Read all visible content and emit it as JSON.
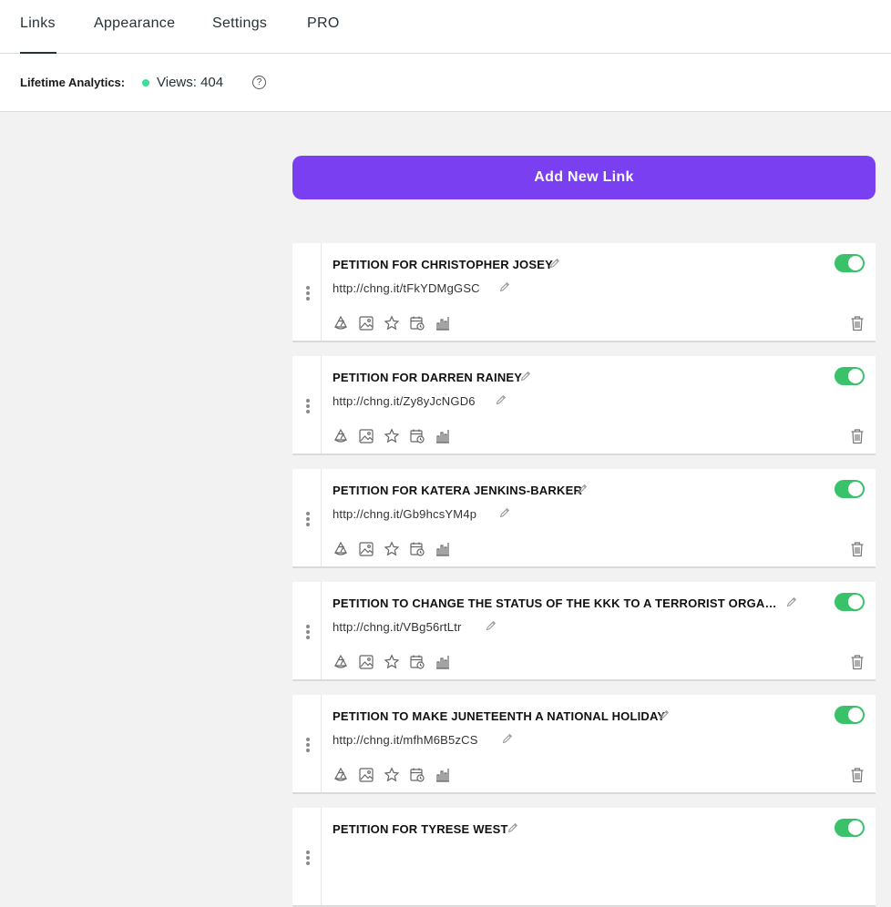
{
  "tabs": [
    {
      "label": "Links",
      "active": true
    },
    {
      "label": "Appearance",
      "active": false
    },
    {
      "label": "Settings",
      "active": false
    },
    {
      "label": "PRO",
      "active": false
    }
  ],
  "analytics": {
    "label": "Lifetime Analytics:",
    "views": "Views: 404",
    "help": "?"
  },
  "add_button": "Add New Link",
  "links": [
    {
      "title": "PETITION FOR CHRISTOPHER JOSEY",
      "url": "http://chng.it/tFkYDMgGSC",
      "enabled": true
    },
    {
      "title": "PETITION FOR DARREN RAINEY",
      "url": "http://chng.it/Zy8yJcNGD6",
      "enabled": true
    },
    {
      "title": "PETITION FOR KATERA JENKINS-BARKER",
      "url": "http://chng.it/Gb9hcsYM4p",
      "enabled": true
    },
    {
      "title": "PETITION TO CHANGE THE STATUS OF THE KKK TO A TERRORIST ORGANIZ...",
      "url": "http://chng.it/VBg56rtLtr",
      "enabled": true
    },
    {
      "title": "PETITION TO MAKE JUNETEENTH A NATIONAL HOLIDAY",
      "url": "http://chng.it/mfhM6B5zCS",
      "enabled": true
    },
    {
      "title": "PETITION FOR TYRESE WEST",
      "url": "",
      "enabled": true
    }
  ],
  "colors": {
    "accent": "#7b3ff2",
    "toggle_on": "#39c26a",
    "status_dot": "#39e09b"
  },
  "tool_icons": [
    "animation-icon",
    "image-icon",
    "star-icon",
    "schedule-icon",
    "analytics-icon"
  ]
}
